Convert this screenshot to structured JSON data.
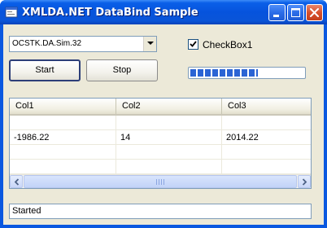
{
  "window": {
    "title": "XMLDA.NET DataBind Sample",
    "accent_color": "#0a5fe8",
    "controls": {
      "minimize_icon": "minimize-icon",
      "maximize_icon": "maximize-icon",
      "close_icon": "close-icon"
    }
  },
  "server_combo": {
    "selected_value": "OCSTK.DA.Sim.32",
    "dropdown_icon": "chevron-down-icon"
  },
  "checkbox": {
    "label": "CheckBox1",
    "checked": true
  },
  "buttons": {
    "start_label": "Start",
    "stop_label": "Stop"
  },
  "progress": {
    "fraction": 0.6,
    "color": "#2b64d4"
  },
  "grid": {
    "columns": [
      "Col1",
      "Col2",
      "Col3"
    ],
    "rows": [
      [
        "-1986.22",
        "14",
        "2014.22"
      ]
    ]
  },
  "status": {
    "text": "Started"
  }
}
